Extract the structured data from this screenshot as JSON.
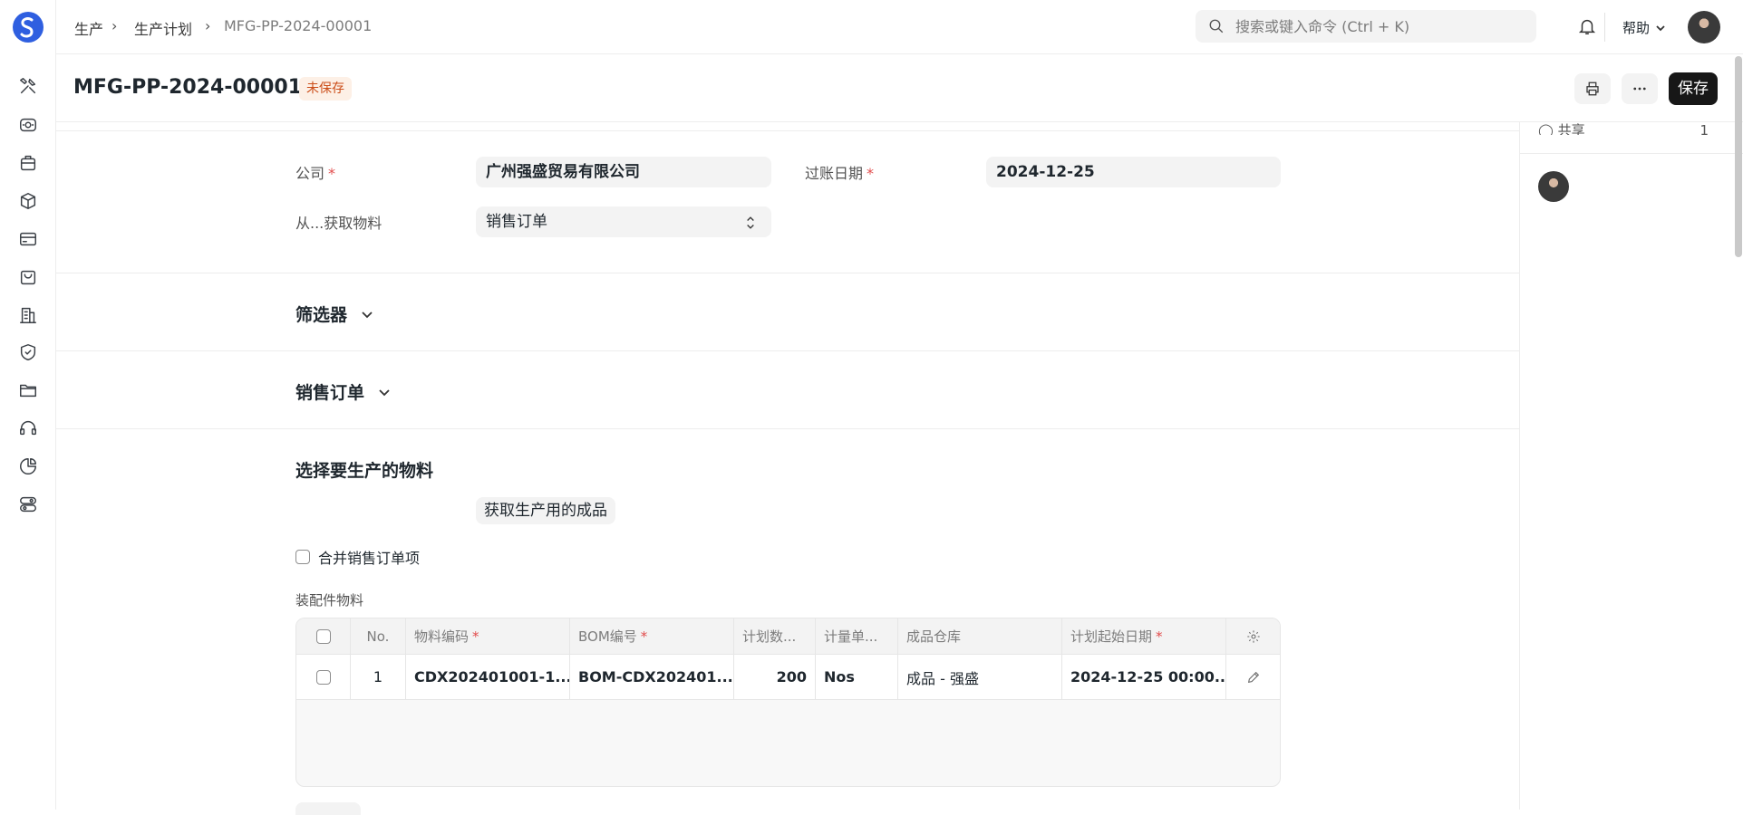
{
  "nav": {
    "breadcrumbs": [
      "生产",
      "生产计划",
      "MFG-PP-2024-00001"
    ],
    "search_placeholder": "搜索或键入命令 (Ctrl + K)",
    "help_label": "帮助"
  },
  "sidebar_icons": [
    "tools-icon",
    "eye-icon",
    "briefcase-icon",
    "box-icon",
    "card-icon",
    "shopping-bag-icon",
    "building-icon",
    "shield-icon",
    "folder-icon",
    "headset-icon",
    "pie-chart-icon",
    "toggles-icon"
  ],
  "header": {
    "title": "MFG-PP-2024-00001",
    "status_badge": "未保存",
    "save_label": "保存"
  },
  "right_sidebar": {
    "share_label": "共享",
    "share_count": "1"
  },
  "form": {
    "company_label": "公司",
    "company_value": "广州强盛贸易有限公司",
    "posting_date_label": "过账日期",
    "posting_date_value": "2024-12-25",
    "get_items_from_label": "从...获取物料",
    "get_items_from_value": "销售订单",
    "filters_title": "筛选器",
    "sales_orders_title": "销售订单",
    "select_items_title": "选择要生产的物料",
    "get_fg_button": "获取生产用的成品",
    "combine_items_label": "合并销售订单项",
    "assembly_items_label": "装配件物料"
  },
  "table": {
    "headers": [
      "No.",
      "物料编码",
      "BOM编号",
      "计划数...",
      "计量单...",
      "成品仓库",
      "计划起始日期"
    ],
    "required": [
      false,
      true,
      true,
      false,
      false,
      false,
      true
    ],
    "rows": [
      [
        "1",
        "CDX202401001-1...",
        "BOM-CDX202401...",
        "200",
        "Nos",
        "成品 - 强盛",
        "2024-12-25 00:00..."
      ]
    ]
  },
  "colors": {
    "accent": "#171717",
    "unsaved_bg": "#fdf0e6",
    "unsaved_text": "#cb4d18",
    "required_star": "#e24c4c"
  }
}
